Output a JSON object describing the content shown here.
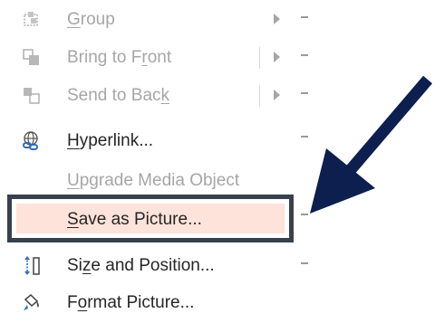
{
  "menu": {
    "items": [
      {
        "id": "group",
        "label_parts": [
          "",
          "G",
          "roup"
        ],
        "enabled": false,
        "submenu": true,
        "split": false,
        "icon": "group-icon"
      },
      {
        "id": "bring-to-front",
        "label_parts": [
          "Bring to F",
          "r",
          "ont"
        ],
        "enabled": false,
        "submenu": true,
        "split": true,
        "icon": "bring-to-front-icon"
      },
      {
        "id": "send-to-back",
        "label_parts": [
          "Send to Bac",
          "k",
          ""
        ],
        "enabled": false,
        "submenu": true,
        "split": true,
        "icon": "send-to-back-icon"
      },
      {
        "id": "hyperlink",
        "label_parts": [
          "",
          "H",
          "yperlink..."
        ],
        "enabled": true,
        "submenu": false,
        "split": false,
        "icon": "hyperlink-icon"
      },
      {
        "id": "upgrade-media-object",
        "label_parts": [
          "",
          "U",
          "pgrade Media Object"
        ],
        "enabled": false,
        "submenu": false,
        "split": false,
        "icon": ""
      },
      {
        "id": "save-as-picture",
        "label_parts": [
          "",
          "S",
          "ave as Picture..."
        ],
        "enabled": true,
        "submenu": false,
        "split": false,
        "icon": "",
        "highlighted": true
      },
      {
        "id": "size-and-position",
        "label_parts": [
          "Si",
          "z",
          "e and Position..."
        ],
        "enabled": true,
        "submenu": false,
        "split": false,
        "icon": "size-position-icon"
      },
      {
        "id": "format-picture",
        "label_parts": [
          "F",
          "o",
          "rmat Picture..."
        ],
        "enabled": true,
        "submenu": false,
        "split": false,
        "icon": "format-picture-icon"
      }
    ]
  },
  "colors": {
    "disabled_text": "#a6a6a6",
    "enabled_text": "#262626",
    "highlight_fill": "#fde3da",
    "highlight_border": "#38404e",
    "pointer_arrow": "#0c1f4f"
  }
}
